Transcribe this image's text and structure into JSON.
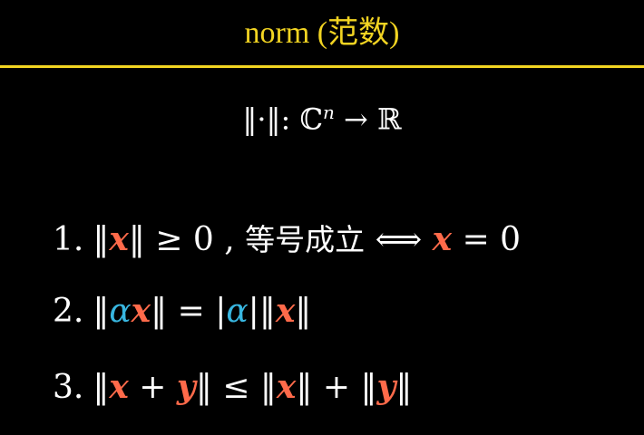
{
  "title": "norm (范数)",
  "mapping": {
    "norm_symbol": "‖·‖",
    "colon": ":",
    "domain": "ℂ",
    "exponent": "n",
    "arrow": "→",
    "codomain": "ℝ"
  },
  "properties": [
    {
      "number": "1.",
      "parts": {
        "bar1": "‖",
        "x": "x",
        "bar2": "‖",
        "rel": "≥ 0 ,",
        "text": "等号成立",
        "iff": "⟺",
        "x2": "x",
        "eq": "= 0"
      }
    },
    {
      "number": "2.",
      "parts": {
        "bar1": "‖",
        "alpha": "α",
        "x": "x",
        "bar2": "‖",
        "eq": "=",
        "abs1": "|",
        "alpha2": "α",
        "abs2": "|",
        "bar3": "‖",
        "x2": "x",
        "bar4": "‖"
      }
    },
    {
      "number": "3.",
      "parts": {
        "bar1": "‖",
        "x": "x",
        "plus": "+",
        "y": "y",
        "bar2": "‖",
        "le": "≤",
        "bar3": "‖",
        "x2": "x",
        "bar4": "‖",
        "plus2": "+",
        "bar5": "‖",
        "y2": "y",
        "bar6": "‖"
      }
    }
  ],
  "colors": {
    "title": "#f2d422",
    "vector": "#ff6a4a",
    "scalar": "#38b6e0",
    "background": "#000000",
    "text": "#ffffff"
  }
}
